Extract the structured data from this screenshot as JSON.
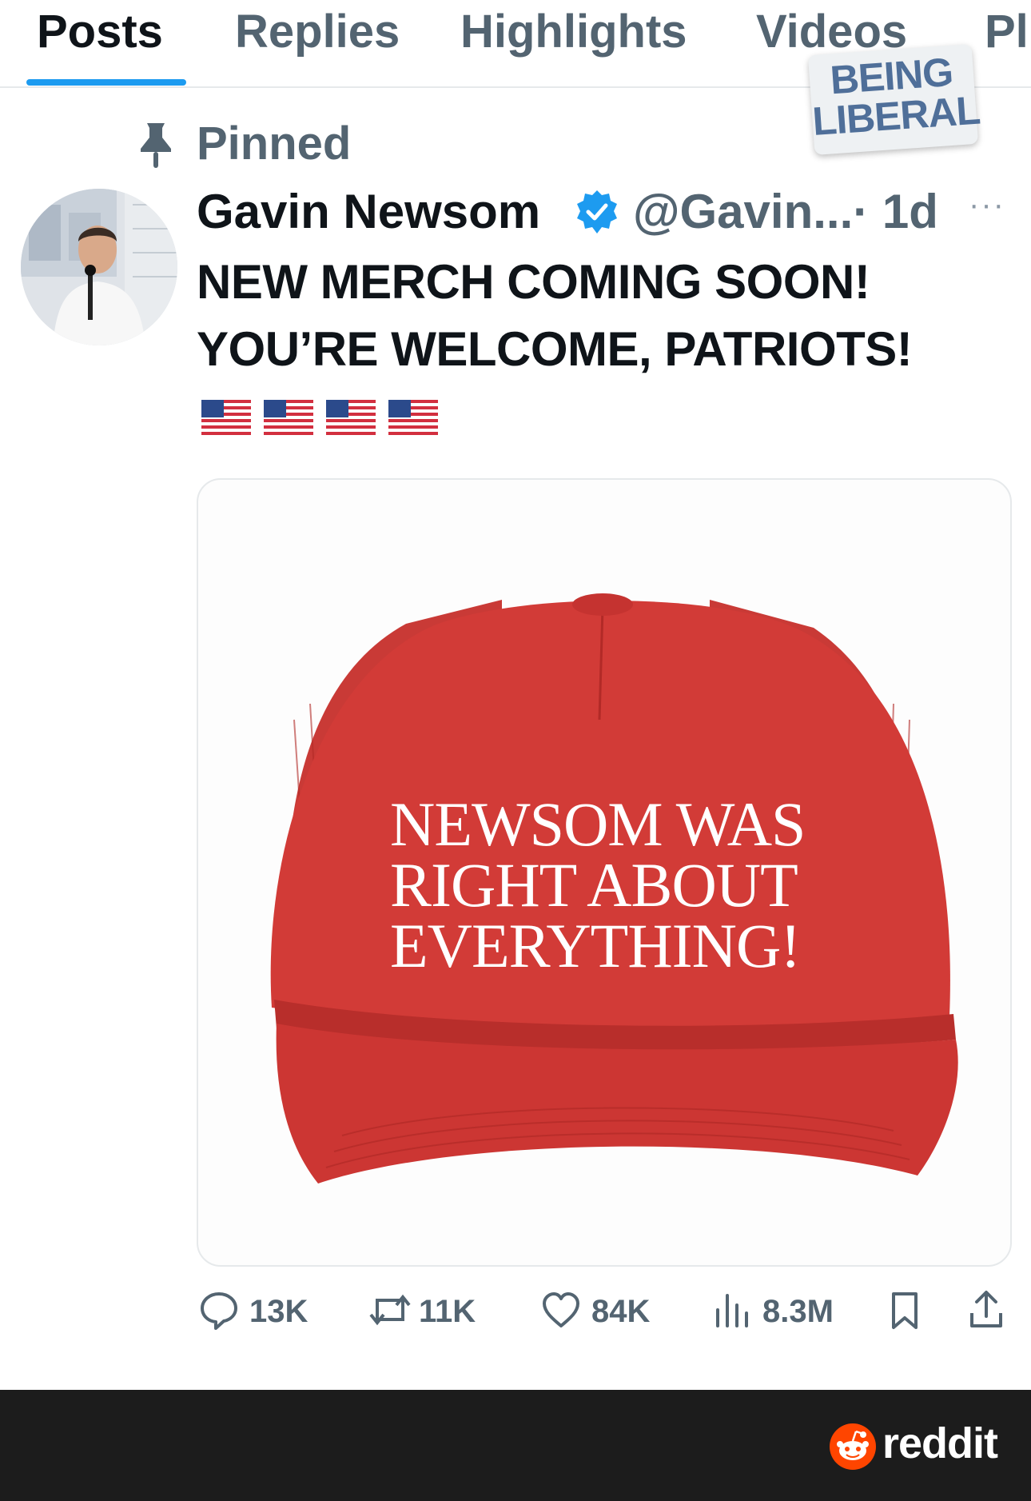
{
  "tabs": [
    {
      "label": "Posts",
      "active": true
    },
    {
      "label": "Replies",
      "active": false
    },
    {
      "label": "Highlights",
      "active": false
    },
    {
      "label": "Videos",
      "active": false
    },
    {
      "label": "Pl",
      "active": false
    }
  ],
  "watermark": {
    "line1": "BEING",
    "line2": "LIBERAL"
  },
  "pinned": {
    "label": "Pinned",
    "icon": "pin-icon"
  },
  "post": {
    "author_name": "Gavin Newsom",
    "verified": true,
    "handle": "@Gavin...",
    "time": "· 1d",
    "more": "···",
    "text_line1": "NEW MERCH COMING SOON!",
    "text_line2": "YOU’RE WELCOME, PATRIOTS!",
    "flags": [
      "us-flag",
      "us-flag",
      "us-flag",
      "us-flag"
    ],
    "media": {
      "hat_color": "#c8302f",
      "hat_line1": "NEWSOM WAS",
      "hat_line2": "RIGHT ABOUT",
      "hat_line3": "EVERYTHING!"
    },
    "actions": {
      "replies": "13K",
      "reposts": "11K",
      "likes": "84K",
      "views": "8.3M"
    }
  },
  "footer": {
    "brand": "reddit",
    "brand_color": "#ff4500"
  },
  "colors": {
    "accent": "#1d9bf0",
    "muted": "#536471",
    "text": "#0f1419"
  }
}
